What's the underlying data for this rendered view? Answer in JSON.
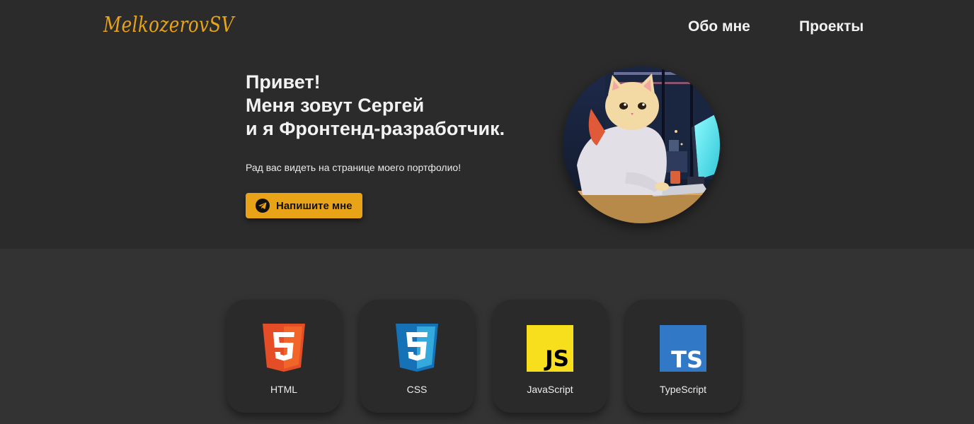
{
  "header": {
    "logo": "MelkozerovSV",
    "nav": {
      "about": "Обо мне",
      "projects": "Проекты"
    }
  },
  "hero": {
    "heading": {
      "line1": "Привет!",
      "line2": "Меня зовут Сергей",
      "line3": "и я Фронтенд-разработчик."
    },
    "subtitle": "Рад вас видеть на странице моего портфолио!",
    "contact_button": {
      "label": "Напишите мне",
      "icon": "telegram-icon"
    },
    "avatar": "cat-developer-illustration"
  },
  "skills": [
    {
      "label": "HTML",
      "icon": "html5-icon"
    },
    {
      "label": "CSS",
      "icon": "css3-icon"
    },
    {
      "label": "JavaScript",
      "icon": "javascript-icon"
    },
    {
      "label": "TypeScript",
      "icon": "typescript-icon"
    }
  ],
  "colors": {
    "accent": "#e8a317",
    "header_bg": "#2b2b2b",
    "page_bg": "#333333",
    "card_bg": "#2a2a2a",
    "text": "#f2f2f2"
  }
}
